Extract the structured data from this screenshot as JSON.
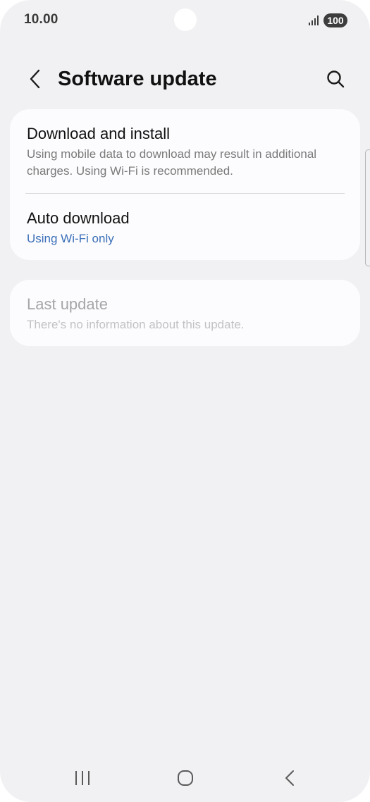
{
  "status_bar": {
    "time": "10.00",
    "battery": "100",
    "icons": [
      "signal-icon",
      "battery-icon"
    ]
  },
  "header": {
    "title": "Software update",
    "icons": [
      "back-arrow-icon",
      "search-icon"
    ]
  },
  "settings": {
    "download_and_install": {
      "title": "Download and install",
      "subtitle": "Using mobile data to download may result in additional charges. Using Wi-Fi is recommended."
    },
    "auto_download": {
      "title": "Auto download",
      "value": "Using Wi-Fi only"
    },
    "last_update": {
      "title": "Last update",
      "subtitle": "There's no information about this update."
    }
  },
  "nav_bar": {
    "icons": [
      "recent-apps-icon",
      "home-icon",
      "back-icon"
    ]
  },
  "colors": {
    "background": "#f1f1f3",
    "card": "#fcfcfe",
    "accent": "#3b6fb8",
    "disabled_text": "#a6a6a8"
  }
}
